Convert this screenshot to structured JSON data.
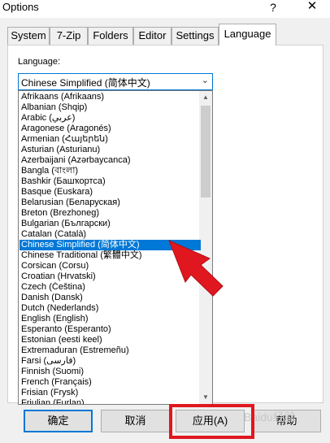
{
  "window": {
    "title": "Options",
    "help_glyph": "?",
    "close_glyph": "✕"
  },
  "tabs": [
    {
      "label": "System"
    },
    {
      "label": "7-Zip"
    },
    {
      "label": "Folders"
    },
    {
      "label": "Editor"
    },
    {
      "label": "Settings"
    },
    {
      "label": "Language"
    }
  ],
  "active_tab": "Language",
  "language_section": {
    "label": "Language:",
    "selected_value": "Chinese Simplified (简体中文)",
    "options": [
      "Afrikaans (Afrikaans)",
      "Albanian (Shqip)",
      "Arabic (عربي)",
      "Aragonese (Aragonés)",
      "Armenian (Հայերեն)",
      "Asturian (Asturianu)",
      "Azerbaijani (Azərbaycanca)",
      "Bangla (বাংলা)",
      "Bashkir (Башҡортса)",
      "Basque (Euskara)",
      "Belarusian (Беларуская)",
      "Breton (Brezhoneg)",
      "Bulgarian (Български)",
      "Catalan (Català)",
      "Chinese Simplified (简体中文)",
      "Chinese Traditional (繁體中文)",
      "Corsican (Corsu)",
      "Croatian (Hrvatski)",
      "Czech (Čeština)",
      "Danish (Dansk)",
      "Dutch (Nederlands)",
      "English (English)",
      "Esperanto (Esperanto)",
      "Estonian (eesti keel)",
      "Extremaduran (Estremeñu)",
      "Farsi (فارسی)",
      "Finnish (Suomi)",
      "French (Français)",
      "Frisian (Frysk)",
      "Friulian (Furlan)"
    ],
    "selected_index": 14
  },
  "buttons": {
    "ok": "确定",
    "cancel": "取消",
    "apply": "应用(A)",
    "help": "帮助"
  },
  "watermark": "Baidu经验",
  "colors": {
    "selection": "#0078d7",
    "annotation_red": "#e0171f"
  }
}
